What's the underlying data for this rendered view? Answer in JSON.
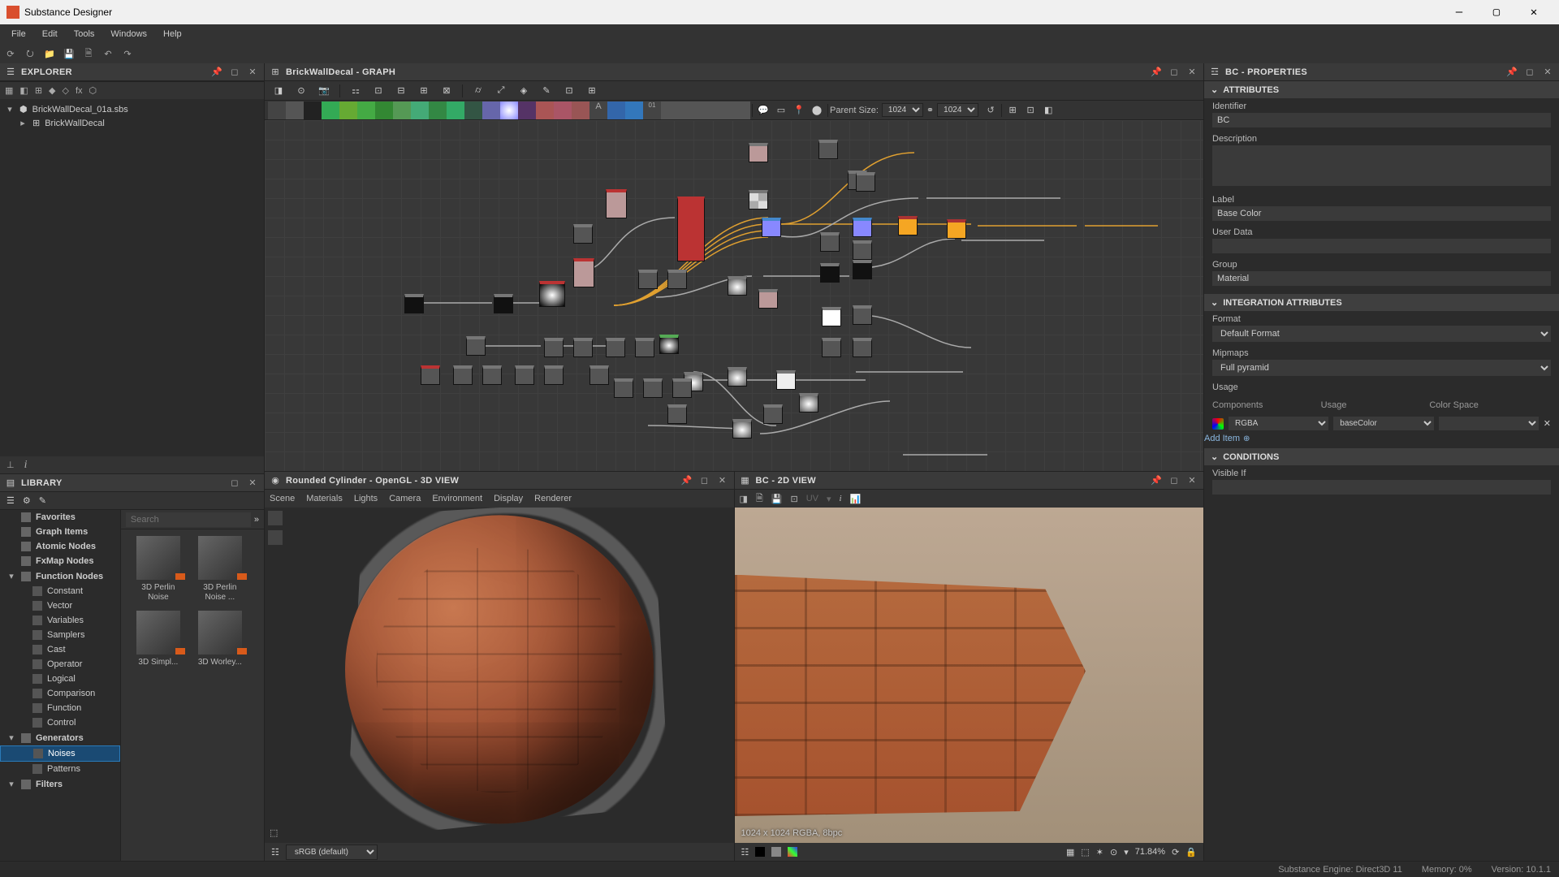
{
  "app": {
    "title": "Substance Designer"
  },
  "menu": {
    "items": [
      "File",
      "Edit",
      "Tools",
      "Windows",
      "Help"
    ]
  },
  "explorer": {
    "title": "EXPLORER",
    "root": "BrickWallDecal_01a.sbs",
    "child": "BrickWallDecal"
  },
  "graph": {
    "title": "BrickWallDecal - GRAPH",
    "parent_size_label": "Parent Size:",
    "size1": "1024",
    "size2": "1024"
  },
  "library": {
    "title": "LIBRARY",
    "search_placeholder": "Search",
    "categories": [
      {
        "label": "Favorites",
        "depth": 0,
        "arrow": ""
      },
      {
        "label": "Graph Items",
        "depth": 0,
        "arrow": ""
      },
      {
        "label": "Atomic Nodes",
        "depth": 0,
        "arrow": ""
      },
      {
        "label": "FxMap Nodes",
        "depth": 0,
        "arrow": ""
      },
      {
        "label": "Function Nodes",
        "depth": 0,
        "arrow": "▾"
      },
      {
        "label": "Constant",
        "depth": 1,
        "arrow": ""
      },
      {
        "label": "Vector",
        "depth": 1,
        "arrow": ""
      },
      {
        "label": "Variables",
        "depth": 1,
        "arrow": ""
      },
      {
        "label": "Samplers",
        "depth": 1,
        "arrow": ""
      },
      {
        "label": "Cast",
        "depth": 1,
        "arrow": ""
      },
      {
        "label": "Operator",
        "depth": 1,
        "arrow": ""
      },
      {
        "label": "Logical",
        "depth": 1,
        "arrow": ""
      },
      {
        "label": "Comparison",
        "depth": 1,
        "arrow": ""
      },
      {
        "label": "Function",
        "depth": 1,
        "arrow": ""
      },
      {
        "label": "Control",
        "depth": 1,
        "arrow": ""
      },
      {
        "label": "Generators",
        "depth": 0,
        "arrow": "▾"
      },
      {
        "label": "Noises",
        "depth": 1,
        "arrow": "",
        "selected": true
      },
      {
        "label": "Patterns",
        "depth": 1,
        "arrow": ""
      },
      {
        "label": "Filters",
        "depth": 0,
        "arrow": "▾"
      }
    ],
    "items": [
      {
        "label": "3D Perlin Noise"
      },
      {
        "label": "3D Perlin Noise ..."
      },
      {
        "label": "3D Simpl..."
      },
      {
        "label": "3D Worley..."
      }
    ]
  },
  "view3d": {
    "title": "Rounded Cylinder - OpenGL - 3D VIEW",
    "menus": [
      "Scene",
      "Materials",
      "Lights",
      "Camera",
      "Environment",
      "Display",
      "Renderer"
    ],
    "colorspace": "sRGB (default)"
  },
  "view2d": {
    "title": "BC - 2D VIEW",
    "info": "1024 x 1024  RGBA, 8bpc",
    "zoom": "71.84%",
    "uv_label": "UV"
  },
  "properties": {
    "title": "BC - PROPERTIES",
    "sec_attributes": "ATTRIBUTES",
    "identifier_label": "Identifier",
    "identifier": "BC",
    "description_label": "Description",
    "description": "",
    "label_label": "Label",
    "label": "Base Color",
    "userdata_label": "User Data",
    "userdata": "",
    "group_label": "Group",
    "group": "Material",
    "sec_integration": "INTEGRATION ATTRIBUTES",
    "format_label": "Format",
    "format": "Default Format",
    "mipmaps_label": "Mipmaps",
    "mipmaps": "Full pyramid",
    "usage_label": "Usage",
    "usage_cols": {
      "components": "Components",
      "usage": "Usage",
      "colorspace": "Color Space"
    },
    "usage_row": {
      "components": "RGBA",
      "usage": "baseColor",
      "colorspace": ""
    },
    "add_item": "Add Item",
    "sec_conditions": "CONDITIONS",
    "visibleif_label": "Visible If",
    "visibleif": ""
  },
  "status": {
    "engine": "Substance Engine: Direct3D 11",
    "memory": "Memory: 0%",
    "version": "Version: 10.1.1"
  }
}
